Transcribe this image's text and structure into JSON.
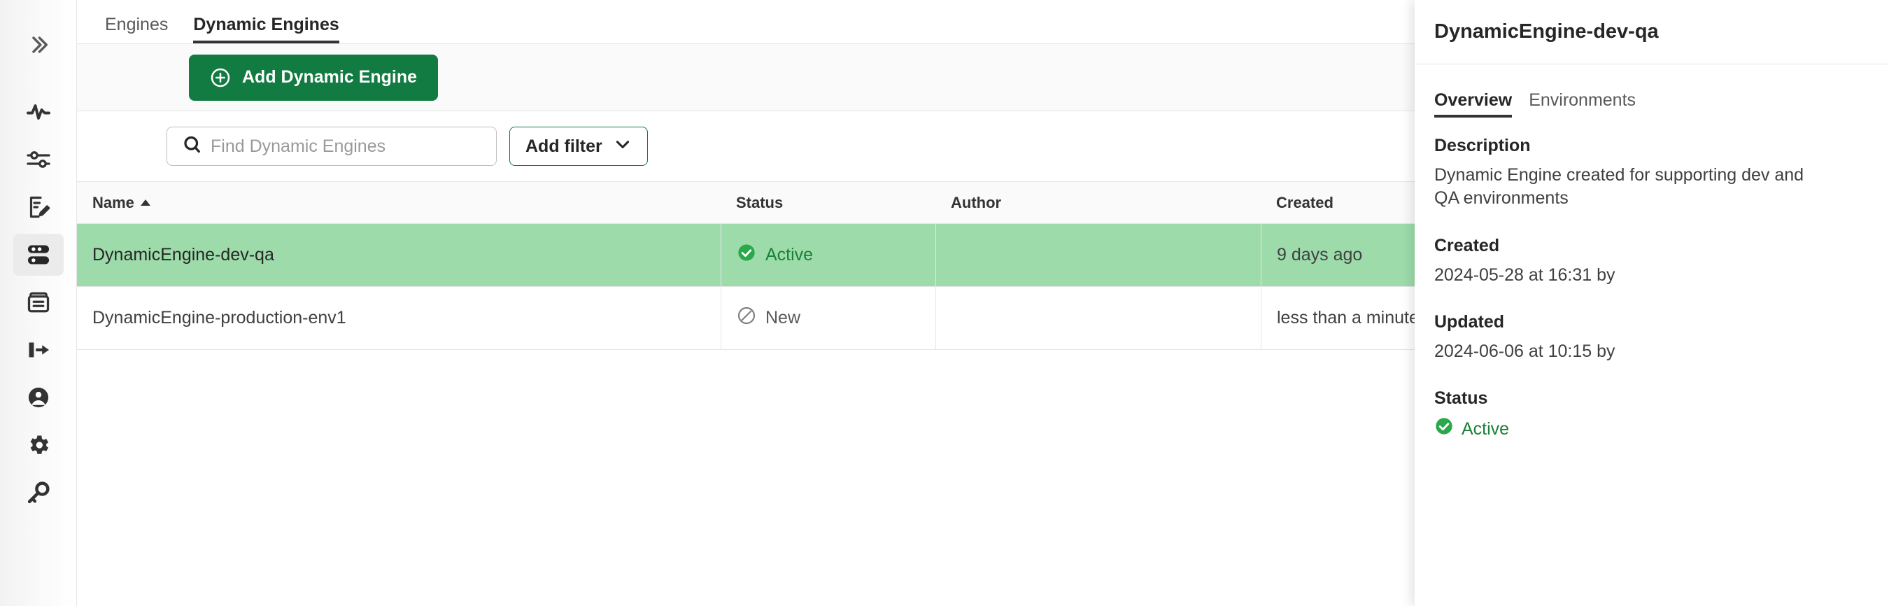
{
  "colors": {
    "brand_green": "#117b41",
    "status_active_green": "#1a7f37",
    "selected_row_green": "#9ddcaa",
    "status_new_gray": "#595959"
  },
  "sidebar": {
    "expand_icon": "chevron-double-right-icon",
    "items": [
      {
        "icon": "activity-pulse-icon",
        "name": "monitoring",
        "active": false
      },
      {
        "icon": "sliders-settings-icon",
        "name": "configuration",
        "active": false
      },
      {
        "icon": "document-edit-icon",
        "name": "editor",
        "active": false
      },
      {
        "icon": "server-stack-icon",
        "name": "engines",
        "active": true
      },
      {
        "icon": "archive-box-icon",
        "name": "archive",
        "active": false
      },
      {
        "icon": "export-arrow-icon",
        "name": "export",
        "active": false
      },
      {
        "icon": "account-circle-icon",
        "name": "users",
        "active": false
      },
      {
        "icon": "gear-icon",
        "name": "settings",
        "active": false
      },
      {
        "icon": "key-icon",
        "name": "credentials",
        "active": false
      }
    ]
  },
  "main": {
    "tabs": [
      {
        "label": "Engines",
        "selected": false
      },
      {
        "label": "Dynamic Engines",
        "selected": true
      }
    ],
    "add_button": {
      "label": "Add Dynamic Engine",
      "icon": "plus-circle-icon"
    },
    "search": {
      "placeholder": "Find Dynamic Engines",
      "value": "",
      "icon": "search-icon"
    },
    "filter_button": {
      "label": "Add filter",
      "icon": "chevron-down-icon"
    },
    "table": {
      "columns": [
        {
          "label": "Name",
          "sorted": true,
          "sort_direction": "asc"
        },
        {
          "label": "Status",
          "sorted": false
        },
        {
          "label": "Author",
          "sorted": false
        },
        {
          "label": "Created",
          "sorted": false
        }
      ],
      "rows": [
        {
          "name": "DynamicEngine-dev-qa",
          "status": "Active",
          "status_icon": "check-circle-filled-icon",
          "author": "",
          "created": "9 days ago",
          "selected": true
        },
        {
          "name": "DynamicEngine-production-env1",
          "status": "New",
          "status_icon": "circle-slash-icon",
          "author": "",
          "created": "less than a minute ago",
          "selected": false
        }
      ]
    }
  },
  "detail": {
    "title": "DynamicEngine-dev-qa",
    "tabs": [
      {
        "label": "Overview",
        "selected": true
      },
      {
        "label": "Environments",
        "selected": false
      }
    ],
    "fields": [
      {
        "label": "Description",
        "value": "Dynamic Engine created for supporting dev and QA environments"
      },
      {
        "label": "Created",
        "value": "2024-05-28 at 16:31 by"
      },
      {
        "label": "Updated",
        "value": "2024-06-06 at 10:15 by"
      }
    ],
    "status": {
      "label": "Status",
      "value": "Active",
      "icon": "check-circle-filled-icon"
    }
  }
}
